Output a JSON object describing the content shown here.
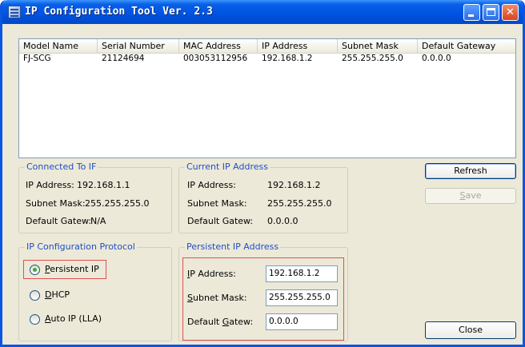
{
  "window": {
    "title": "IP Configuration Tool  Ver. 2.3"
  },
  "table": {
    "columns": [
      "Model Name",
      "Serial Number",
      "MAC Address",
      "IP Address",
      "Subnet Mask",
      "Default Gateway"
    ],
    "rows": [
      [
        "FJ-SCG",
        "21124694",
        "003053112956",
        "192.168.1.2",
        "255.255.255.0",
        "0.0.0.0"
      ]
    ]
  },
  "connected": {
    "title": "Connected To IF",
    "ip_label": "IP Address:",
    "ip_value": "192.168.1.1",
    "mask_label": "Subnet Mask:",
    "mask_value": "255.255.255.0",
    "gw_label": "Default Gatew:",
    "gw_value": "N/A"
  },
  "current": {
    "title": "Current IP Address",
    "ip_label": "IP Address:",
    "ip_value": "192.168.1.2",
    "mask_label": "Subnet Mask:",
    "mask_value": "255.255.255.0",
    "gw_label": "Default Gatew:",
    "gw_value": "0.0.0.0"
  },
  "protocol": {
    "title": "IP Configuration Protocol",
    "options": [
      {
        "label": "Persistent IP",
        "selected": true
      },
      {
        "label": "DHCP",
        "selected": false
      },
      {
        "label": "Auto IP (LLA)",
        "selected": false
      }
    ]
  },
  "persistent": {
    "title": "Persistent IP Address",
    "ip_label": "IP Address:",
    "ip_value": "192.168.1.2",
    "mask_label": "Subnet Mask:",
    "mask_value": "255.255.255.0",
    "gw_label": "Default Gatew:",
    "gw_value": "0.0.0.0"
  },
  "buttons": {
    "refresh": "Refresh",
    "save": "Save",
    "close": "Close"
  },
  "colors": {
    "titlebar": "#0054e3",
    "group_title": "#1f4ec9",
    "highlight_border": "#e05050",
    "dialog_bg": "#ece9d8"
  }
}
